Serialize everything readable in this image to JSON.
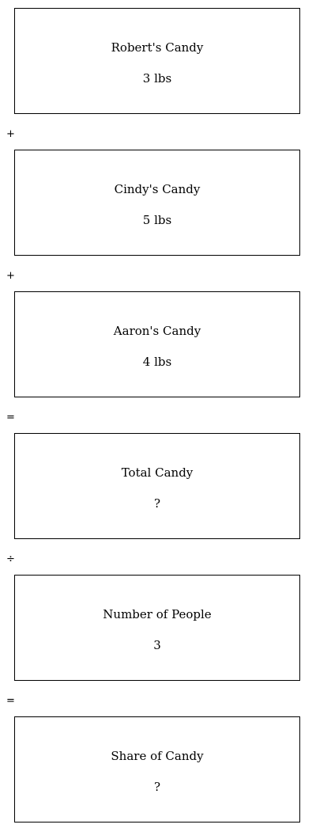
{
  "boxes": [
    {
      "label": "Robert's Candy",
      "value": "3 lbs"
    },
    {
      "label": "Cindy's Candy",
      "value": "5 lbs"
    },
    {
      "label": "Aaron's Candy",
      "value": "4 lbs"
    },
    {
      "label": "Total Candy",
      "value": "?"
    },
    {
      "label": "Number of People",
      "value": "3"
    },
    {
      "label": "Share of Candy",
      "value": "?"
    }
  ],
  "operators": [
    "+",
    "+",
    "=",
    "÷",
    "="
  ]
}
